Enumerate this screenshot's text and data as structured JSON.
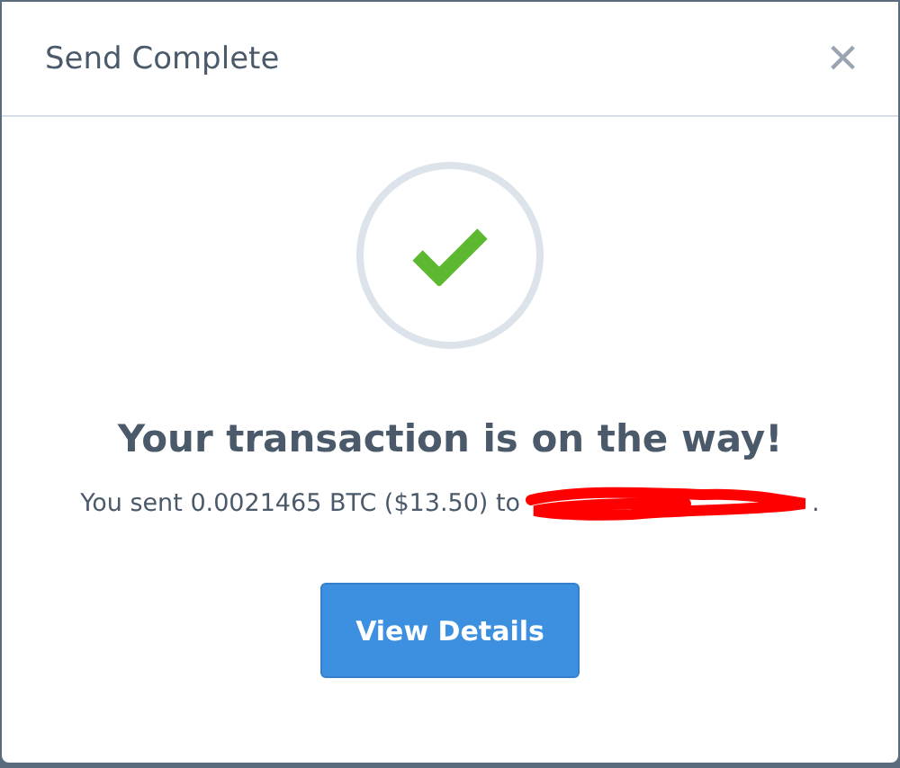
{
  "dialog": {
    "title": "Send Complete",
    "close_label": "×"
  },
  "status": {
    "kind": "success"
  },
  "heading": "Your transaction is on the way!",
  "message": {
    "prefix": "You sent 0.0021465 BTC ($13.50) to",
    "redacted": true,
    "suffix": "."
  },
  "buttons": [
    "View Details"
  ]
}
